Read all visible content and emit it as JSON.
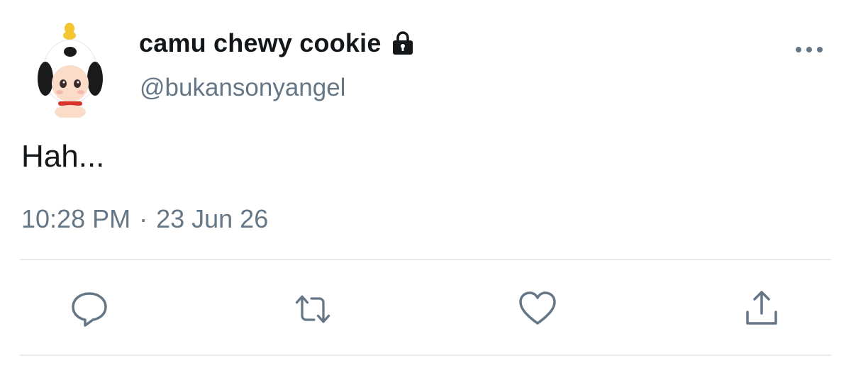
{
  "tweet": {
    "display_name": "camu chewy cookie",
    "handle": "@bukansonyangel",
    "text": "Hah...",
    "time": "10:28 PM",
    "separator": "·",
    "date": "23 Jun 26",
    "protected": true
  },
  "icons": {
    "lock": "lock-icon",
    "more": "more-horizontal-icon",
    "reply": "reply-icon",
    "retweet": "retweet-icon",
    "like": "heart-icon",
    "share": "share-icon"
  },
  "colors": {
    "text_primary": "#14171a",
    "text_secondary": "#657786",
    "divider": "#e6ecf0"
  }
}
